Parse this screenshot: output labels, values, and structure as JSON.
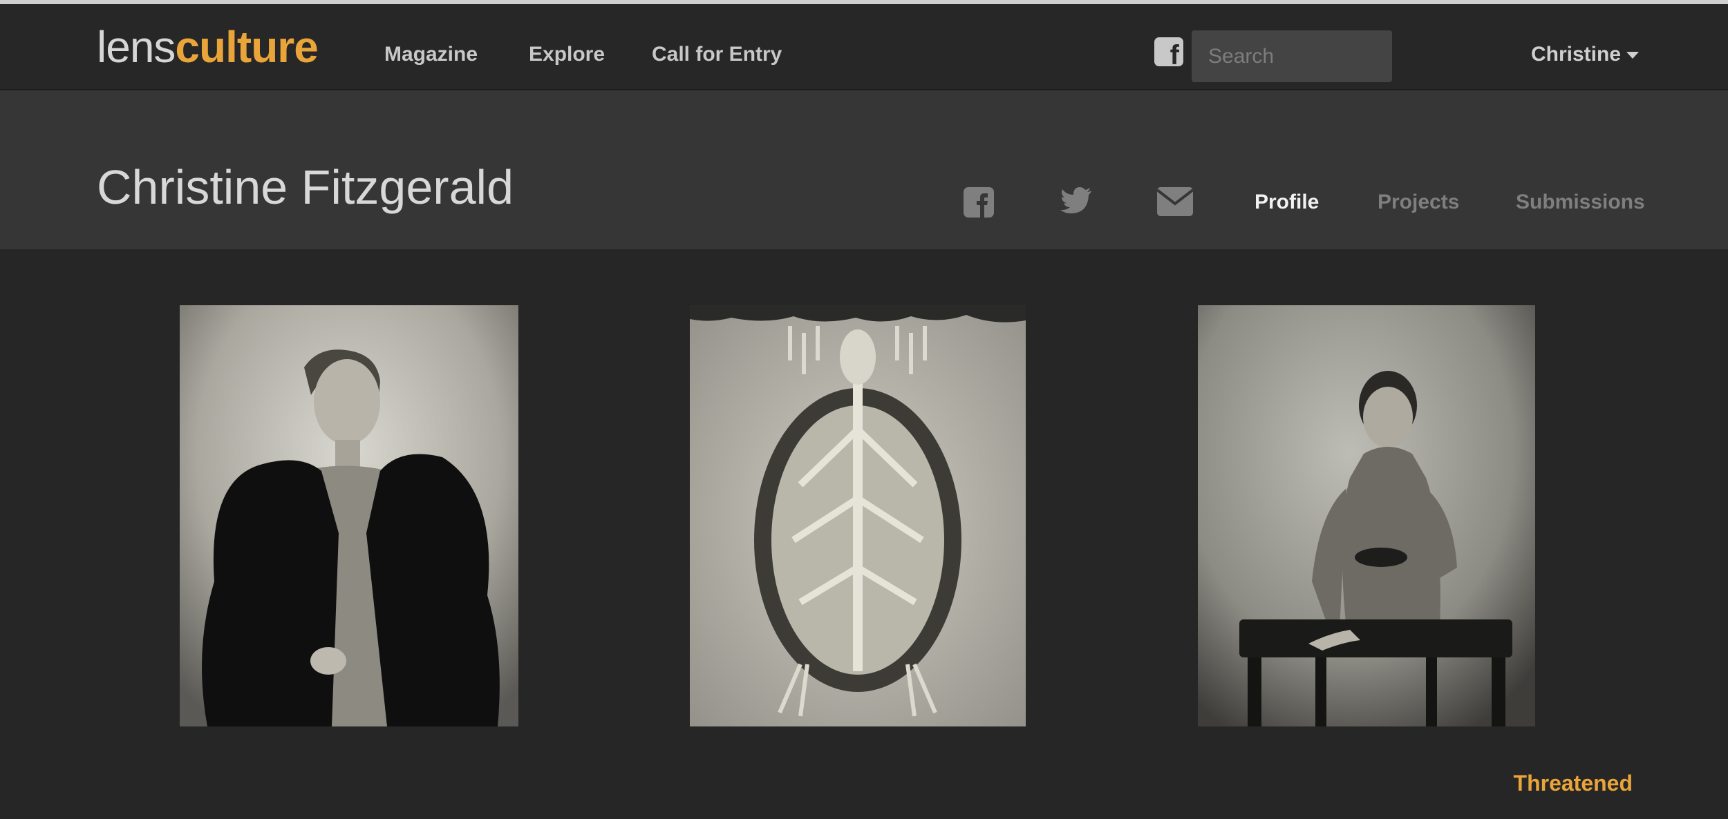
{
  "header": {
    "logo": {
      "part1": "lens",
      "part2": "culture"
    },
    "nav": [
      {
        "label": "Magazine"
      },
      {
        "label": "Explore"
      },
      {
        "label": "Call for Entry"
      }
    ],
    "facebook_icon": "facebook-square-icon",
    "search": {
      "placeholder": "Search",
      "value": ""
    },
    "user": {
      "label": "Christine",
      "icon": "caret-down-icon"
    }
  },
  "profile": {
    "name": "Christine Fitzgerald",
    "social_icons": [
      "facebook-square-icon",
      "twitter-icon",
      "envelope-icon"
    ],
    "tabs": [
      {
        "label": "Profile",
        "active": true
      },
      {
        "label": "Projects",
        "active": false
      },
      {
        "label": "Submissions",
        "active": false
      }
    ]
  },
  "gallery": {
    "photos": [
      {
        "subject": "portrait-boy-fur"
      },
      {
        "subject": "turtle-skeleton"
      },
      {
        "subject": "portrait-girl-bench"
      }
    ],
    "project_title": "Threatened"
  },
  "colors": {
    "accent": "#e9a43a",
    "background": "#262626",
    "header_band": "#363636"
  }
}
